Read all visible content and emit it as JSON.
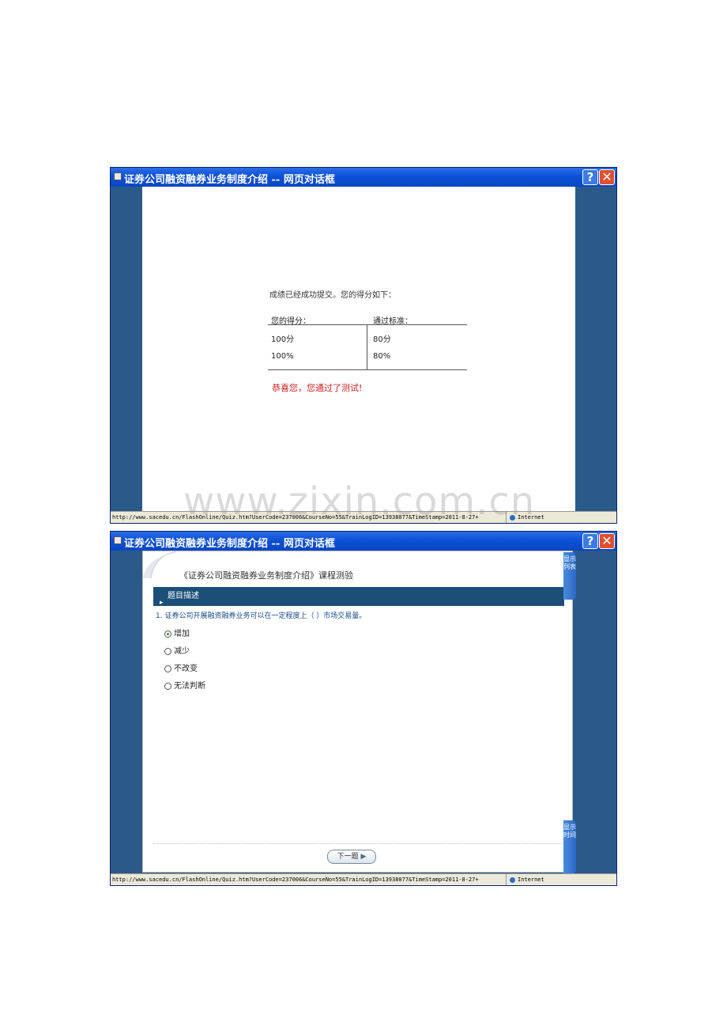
{
  "window1": {
    "title": "证券公司融资融券业务制度介绍 -- 网页对话框",
    "help_glyph": "?",
    "close_glyph": "✕",
    "submit_message": "成绩已经成功提交。您的得分如下：",
    "table": {
      "headers": [
        "您的得分：",
        "通过标准："
      ],
      "rows": [
        [
          "100分",
          "80分"
        ],
        [
          "100%",
          "80%"
        ]
      ]
    },
    "congrats": "恭喜您，您通过了测试!",
    "status_url": "http://www.sacedu.cn/FlashOnline/Quiz.htm?UserCode=237006&CourseNo=55&TrainLogID=13938077&TimeStamp=2011-8-27+",
    "status_zone": "Internet"
  },
  "window2": {
    "title": "证券公司融资融券业务制度介绍 -- 网页对话框",
    "help_glyph": "?",
    "close_glyph": "✕",
    "quiz_title": "《证券公司融资融券业务制度介绍》课程测验",
    "section_label": "题目描述",
    "question": "1. 证券公司开展融资融券业务可以在一定程度上（    ）市场交易量。",
    "options": [
      "增加",
      "减少",
      "不改变",
      "无法判断"
    ],
    "selected_option": "增加",
    "next_button": "下一题",
    "side_tab_top": "显示列表",
    "side_tab_bottom": "显示时间",
    "status_url": "http://www.sacedu.cn/FlashOnline/Quiz.htm?UserCode=237006&CourseNo=55&TrainLogID=13938077&TimeStamp=2011-8-27+",
    "status_zone": "Internet"
  },
  "watermark": "www.zixin.com.cn"
}
